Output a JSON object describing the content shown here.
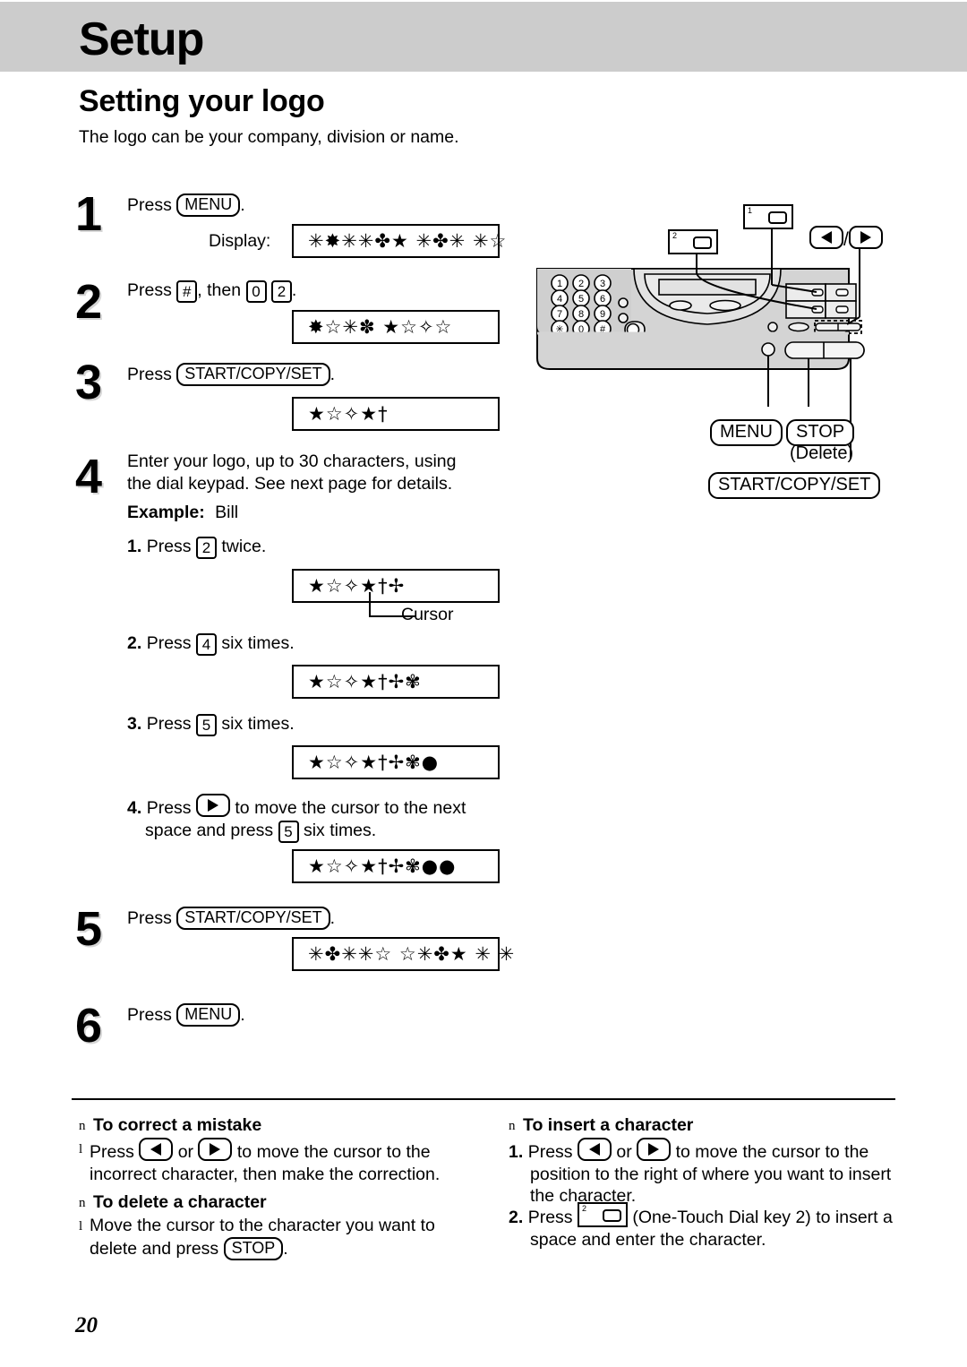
{
  "header": {
    "chapter_title": "Setup"
  },
  "section": {
    "title": "Setting your logo",
    "intro": "The logo can be your company, division or name."
  },
  "steps": [
    {
      "num": "1",
      "text_before": "Press",
      "key": "MENU",
      "text_after": ".",
      "display_label": "Display:",
      "lcd": "✳✸✳✳✤★ ✳✤✳ ✳☆"
    },
    {
      "num": "2",
      "text_before": "Press",
      "key": "#",
      "text_mid": ", then",
      "key2": "0",
      "key3": "2",
      "text_after": ".",
      "lcd": "✸☆✳✽ ★☆✧☆"
    },
    {
      "num": "3",
      "text_before": "Press",
      "key": "START/COPY/SET",
      "text_after": ".",
      "lcd": "★☆✧★†"
    },
    {
      "num": "4",
      "line1": "Enter your logo, up to 30 characters, using",
      "line2": "the dial keypad. See next page for details.",
      "example_label": "Example:",
      "example_value": "Bill",
      "substeps": [
        {
          "n": "1.",
          "before": "Press",
          "key": "2",
          "after": "twice.",
          "lcd": "★☆✧★†✢",
          "cursor_index": 4,
          "cursor_label": "Cursor"
        },
        {
          "n": "2.",
          "before": "Press",
          "key": "4",
          "after": "six times.",
          "lcd": "★☆✧★†✢✾",
          "cursor_index": 5
        },
        {
          "n": "3.",
          "before": "Press",
          "key": "5",
          "after": "six times.",
          "lcd": "★☆✧★†✢✾●",
          "cursor_index": 6
        },
        {
          "n": "4.",
          "before": "Press",
          "key": "arrow-right",
          "mid": "to move the cursor to the next",
          "line2_before": "space and press",
          "key2": "5",
          "line2_after": "six times.",
          "lcd": "★☆✧★†✢✾●●",
          "cursor_index": 6
        }
      ]
    },
    {
      "num": "5",
      "text_before": "Press",
      "key": "START/COPY/SET",
      "text_after": ".",
      "lcd": "✳✤✳✳☆ ☆✳✤★ ✳ ✳"
    },
    {
      "num": "6",
      "text_before": "Press",
      "key": "MENU",
      "text_after": "."
    }
  ],
  "notes": {
    "correct": {
      "heading": "To correct a mistake",
      "bullet": "n",
      "dash": "l",
      "text_a": "Press",
      "key_left": "arrow-left",
      "text_or": "or",
      "key_right": "arrow-right",
      "text_b": "to move the cursor to the",
      "line2": "incorrect character, then make the correction."
    },
    "delete": {
      "heading": "To delete a character",
      "bullet": "n",
      "dash": "l",
      "line1": "Move the cursor to the character you want to",
      "line2_before": "delete and press",
      "key": "STOP",
      "line2_after": "."
    },
    "insert": {
      "heading": "To insert a character",
      "bullet": "n",
      "item1_num": "1.",
      "item1_a": "Press",
      "item1_key_left": "arrow-left",
      "item1_or": "or",
      "item1_key_right": "arrow-right",
      "item1_b": "to move the cursor to the",
      "item1_line2": "position to the right of where you want to insert",
      "item1_line3": "the character.",
      "item2_num": "2.",
      "item2_a": "Press",
      "item2_key": "one-touch-2",
      "item2_b": "(One-Touch Dial key 2) to insert a",
      "item2_line2": "space and enter the character."
    }
  },
  "illustration": {
    "callout_key1": "1",
    "callout_key2": "2",
    "arrow_left": "arrow-left",
    "arrow_sep": "/",
    "arrow_right": "arrow-right",
    "keypad": [
      "1",
      "2",
      "3",
      "4",
      "5",
      "6",
      "7",
      "8",
      "9",
      "✳",
      "0",
      "#"
    ],
    "labels": {
      "menu": "MENU",
      "stop": "STOP",
      "delete": "(Delete)",
      "start": "START/COPY/SET"
    }
  },
  "footer": {
    "page_number": "20"
  },
  "colors": {
    "header_band": "#cccccc",
    "panel_body": "#d4d4d4",
    "panel_light": "#e8e8e8",
    "ink": "#000000"
  }
}
